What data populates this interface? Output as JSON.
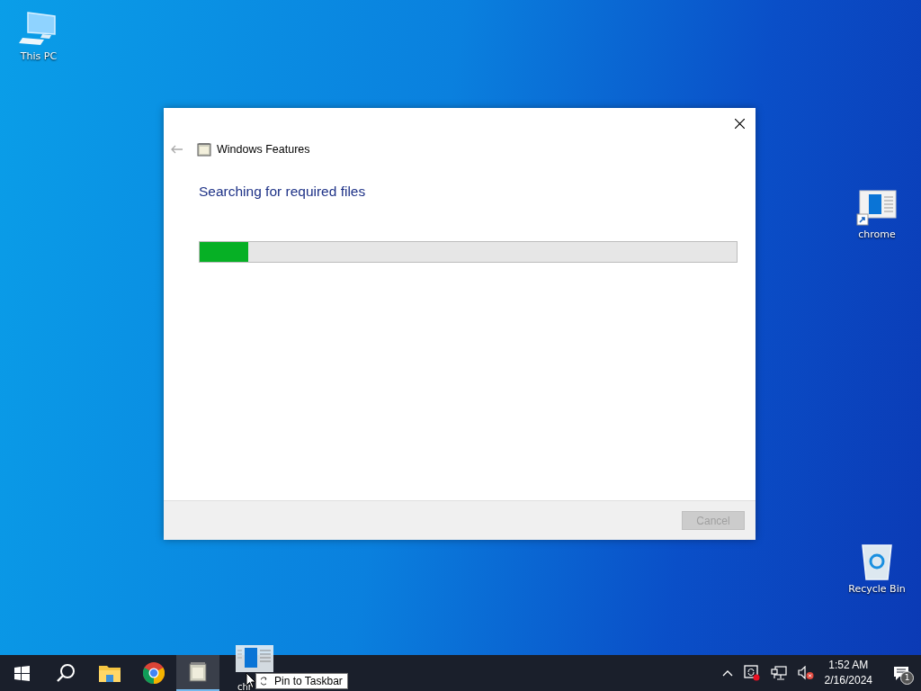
{
  "desktop_icons": [
    {
      "label": "This PC",
      "kind": "pc"
    },
    {
      "label": "chrome",
      "kind": "shortcut"
    },
    {
      "label": "Recycle Bin",
      "kind": "bin"
    }
  ],
  "dialog": {
    "title": "Windows Features",
    "heading": "Searching for required files",
    "progress": {
      "level": 0.09
    },
    "cancel": {
      "label": "Cancel",
      "disabled": true
    }
  },
  "taskbar": {
    "apps": [
      {
        "kind": "start",
        "active": false
      },
      {
        "kind": "search",
        "active": false
      },
      {
        "kind": "explorer",
        "active": false
      },
      {
        "kind": "chrome",
        "active": false
      },
      {
        "kind": "features",
        "active": true
      }
    ]
  },
  "drag": {
    "label": "chr",
    "tooltip": "Pin to Taskbar"
  },
  "tray": {
    "time": "1:52 AM",
    "date": "2/16/2024",
    "notifications": "1"
  }
}
